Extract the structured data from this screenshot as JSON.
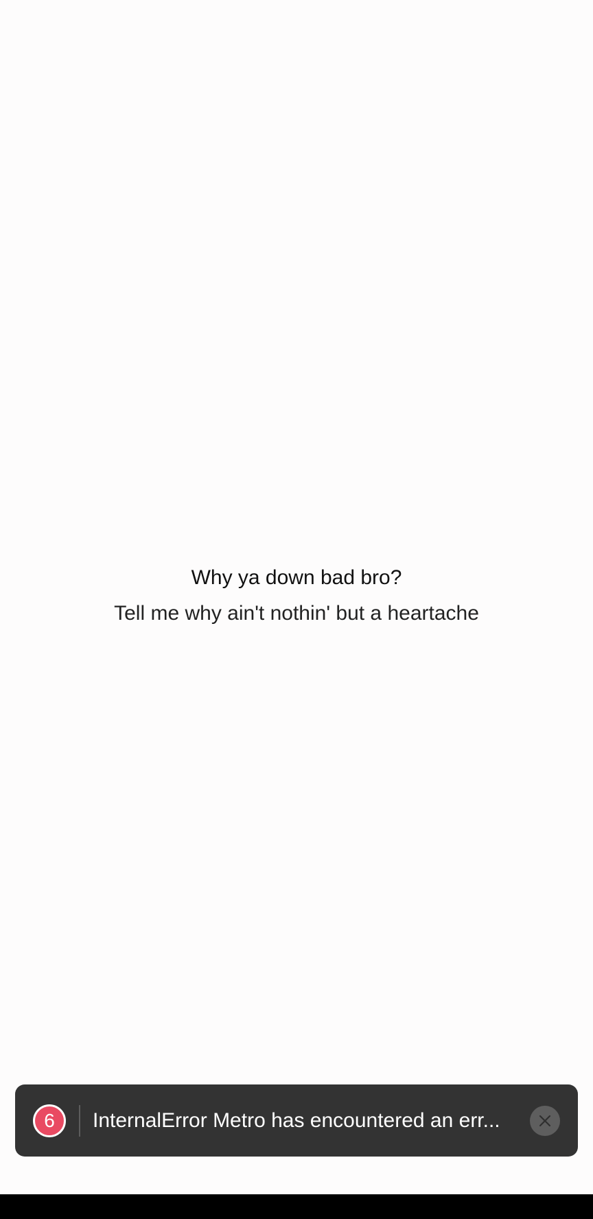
{
  "content": {
    "title": "Why ya down bad bro?",
    "subtitle": "Tell me why ain't nothin' but a heartache"
  },
  "error_toast": {
    "count": "6",
    "message": "InternalError Metro has encountered an err...",
    "badge_color": "#e94a62",
    "background_color": "#333333",
    "close_icon": "close-icon"
  }
}
